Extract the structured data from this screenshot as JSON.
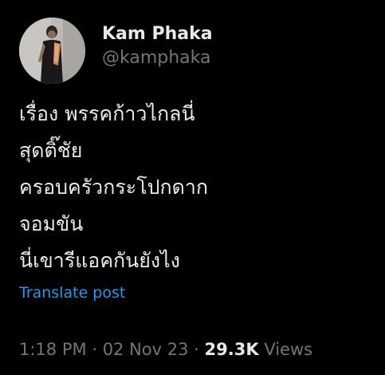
{
  "author": {
    "display_name": "Kam Phaka",
    "handle": "@kamphaka"
  },
  "post": {
    "lines": [
      "เรื่อง พรรคก้าวไกลนี่",
      "สุดติ๊ชัย",
      "ครอบครัวกระโปกดาก",
      "จอมขัน",
      "นี่เขารีแอคกันยังไง"
    ]
  },
  "translate_label": "Translate post",
  "meta": {
    "time": "1:18 PM",
    "separator": "·",
    "date": "02 Nov 23",
    "views_count": "29.3K",
    "views_label": "Views"
  },
  "colors": {
    "background": "#000000",
    "text_primary": "#e7e9ea",
    "text_secondary": "#71767b",
    "link": "#1d9bf0"
  },
  "icons": {
    "avatar": "profile-photo"
  }
}
